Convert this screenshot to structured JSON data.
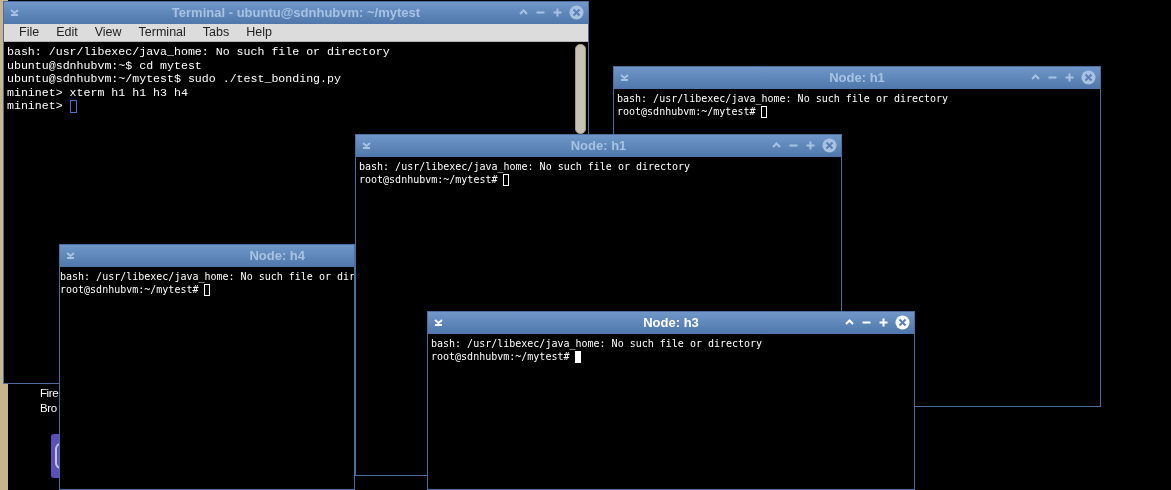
{
  "desktop": {
    "icon_label_lines": [
      "Fire",
      "Bro"
    ]
  },
  "windows": [
    {
      "kind": "terminal",
      "title": "Terminal - ubuntu@sdnhubvm: ~/mytest",
      "active": false,
      "menu": [
        "File",
        "Edit",
        "View",
        "Terminal",
        "Tabs",
        "Help"
      ],
      "lines": [
        "bash: /usr/libexec/java_home: No such file or directory",
        "ubuntu@sdnhubvm:~$ cd mytest",
        "ubuntu@sdnhubvm:~/mytest$ sudo ./test_bonding.py",
        "mininet> xterm h1 h1 h3 h4",
        "mininet>"
      ]
    },
    {
      "kind": "xterm",
      "title": "Node: h1",
      "active": false,
      "lines": [
        "bash: /usr/libexec/java_home: No such file or directory",
        "root@sdnhubvm:~/mytest#"
      ]
    },
    {
      "kind": "xterm",
      "title": "Node: h4",
      "active": false,
      "lines": [
        "bash: /usr/libexec/java_home: No such file or dir",
        "root@sdnhubvm:~/mytest#"
      ]
    },
    {
      "kind": "xterm",
      "title": "Node: h1",
      "active": false,
      "lines": [
        "bash: /usr/libexec/java_home: No such file or directory",
        "root@sdnhubvm:~/mytest#"
      ]
    },
    {
      "kind": "xterm",
      "title": "Node: h3",
      "active": true,
      "lines": [
        "bash: /usr/libexec/java_home: No such file or directory",
        "root@sdnhubvm:~/mytest#"
      ]
    }
  ]
}
